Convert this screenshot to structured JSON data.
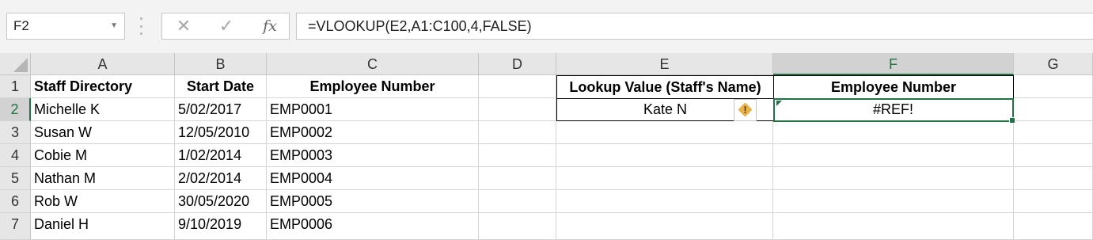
{
  "name_box": {
    "value": "F2"
  },
  "formula_bar": {
    "cancel_icon": "✕",
    "enter_icon": "✓",
    "function_icon": "fx",
    "formula": "=VLOOKUP(E2,A1:C100,4,FALSE)"
  },
  "columns": [
    "A",
    "B",
    "C",
    "D",
    "E",
    "F",
    "G"
  ],
  "selected_column": "F",
  "rows": [
    "1",
    "2",
    "3",
    "4",
    "5",
    "6",
    "7"
  ],
  "selected_row": "2",
  "headers": {
    "a1": "Staff Directory",
    "b1": "Start Date",
    "c1": "Employee Number",
    "e1": "Lookup Value (Staff's Name)",
    "f1": "Employee Number"
  },
  "staff": [
    {
      "name": "Michelle K",
      "start": "5/02/2017",
      "number": "EMP0001"
    },
    {
      "name": "Susan W",
      "start": "12/05/2010",
      "number": "EMP0002"
    },
    {
      "name": "Cobie M",
      "start": "1/02/2014",
      "number": "EMP0003"
    },
    {
      "name": "Nathan M",
      "start": "2/02/2014",
      "number": "EMP0004"
    },
    {
      "name": "Rob W",
      "start": "30/05/2020",
      "number": "EMP0005"
    },
    {
      "name": "Daniel H",
      "start": "9/10/2019",
      "number": "EMP0006"
    }
  ],
  "lookup": {
    "e2": "Kate N",
    "f2": "#REF!"
  },
  "warning_icon": "!",
  "colors": {
    "selection": "#217346",
    "warning": "#e8b34a"
  }
}
